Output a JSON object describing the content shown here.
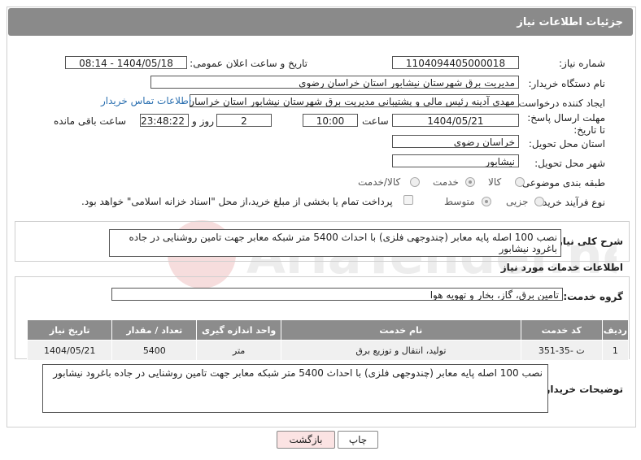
{
  "header": {
    "title": "جزئیات اطلاعات نیاز"
  },
  "fields": {
    "need_number_label": "شماره نیاز:",
    "need_number": "1104094405000018",
    "announce_label": "تاریخ و ساعت اعلان عمومی:",
    "announce_value": "1404/05/18 - 08:14",
    "buyer_org_label": "نام دستگاه خریدار:",
    "buyer_org": "مدیریت برق شهرستان نیشابور استان خراسان رضوی",
    "creator_label": "ایجاد کننده درخواست:",
    "creator": "مهدی آدینه رئیس مالی و پشتیبانی مدیریت برق شهرستان نیشابور استان خراسان رضوی",
    "contact_link": "اطلاعات تماس خریدار",
    "deadline_label": "مهلت ارسال پاسخ: تا تاریخ:",
    "deadline_date": "1404/05/21",
    "time_label": "ساعت",
    "deadline_time": "10:00",
    "days_value": "2",
    "days_label": "روز و",
    "remaining_time": "23:48:22",
    "remaining_label": "ساعت باقی مانده",
    "province_label": "استان محل تحویل:",
    "province": "خراسان رضوی",
    "city_label": "شهر محل تحویل:",
    "city": "نیشابور",
    "category_label": "طبقه بندی موضوعی:",
    "category_options": [
      "کالا",
      "خدمت",
      "کالا/خدمت"
    ],
    "process_label": "نوع فرآیند خرید :",
    "process_options": [
      "جزیی",
      "متوسط"
    ],
    "payment_note": "پرداخت تمام یا بخشی از مبلغ خرید،از محل \"اسناد خزانه اسلامی\" خواهد بود."
  },
  "summary": {
    "label": "شرح کلی نیاز:",
    "text": "نصب 100 اصله پایه معابر (چندوجهی فلزی) با احداث 5400 متر شبکه معابر جهت تامین روشنایی در جاده باغرود نیشابور"
  },
  "services": {
    "section_title": "اطلاعات خدمات مورد نیاز",
    "group_label": "گروه خدمت:",
    "group_value": "تامین برق، گاز، بخار و تهویه هوا",
    "columns": [
      "ردیف",
      "کد خدمت",
      "نام خدمت",
      "واحد اندازه گیری",
      "تعداد / مقدار",
      "تاریخ نیاز"
    ],
    "rows": [
      [
        "1",
        "ت -35-351",
        "تولید، انتقال و توزیع برق",
        "متر",
        "5400",
        "1404/05/21"
      ]
    ]
  },
  "buyer_notes": {
    "label": "توضیحات خریدار:",
    "text": "نصب 100 اصله پایه معابر (چندوجهی فلزی) با احداث 5400 متر شبکه معابر جهت تامین روشنایی در جاده باغرود نیشابور"
  },
  "buttons": {
    "print": "چاپ",
    "back": "بازگشت"
  },
  "watermark": {
    "text": "AriaTender.neT"
  },
  "colors": {
    "header_bg": "#8a8a8a",
    "table_header_bg": "#8c8c8c",
    "link": "#2a6fb0",
    "back_button_bg": "#fbe3e3"
  }
}
